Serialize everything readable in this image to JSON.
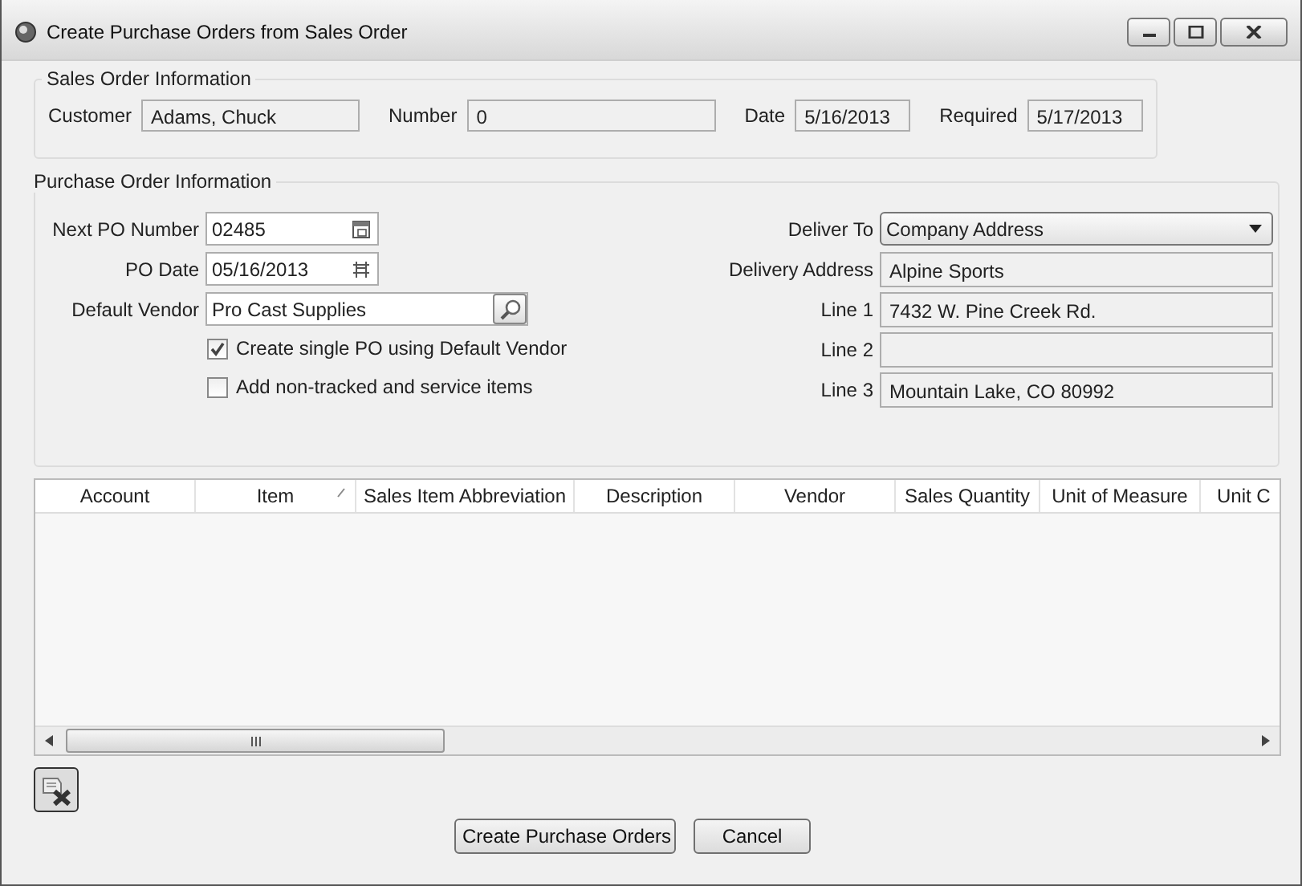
{
  "window": {
    "title": "Create Purchase Orders from Sales Order"
  },
  "sales_order": {
    "title": "Sales Order Information",
    "fields": [
      {
        "label": "Customer",
        "value": "Adams, Chuck"
      },
      {
        "label": "Number",
        "value": "0"
      },
      {
        "label": "Date",
        "value": "5/16/2013"
      },
      {
        "label": "Required",
        "value": "5/17/2013"
      }
    ]
  },
  "purchase_order": {
    "title": "Purchase Order Information",
    "left_fields": [
      {
        "kind": "number",
        "label": "Next PO Number",
        "value": "02485"
      },
      {
        "kind": "date",
        "label": "PO Date",
        "value": "05/16/2013"
      },
      {
        "kind": "lookup",
        "label": "Default Vendor",
        "value": "Pro Cast Supplies"
      }
    ],
    "checkboxes": [
      {
        "label": "Create single PO using Default Vendor",
        "checked": true
      },
      {
        "label": "Add non-tracked and service items",
        "checked": false
      }
    ],
    "right_fields": [
      {
        "kind": "dropdown",
        "label": "Deliver To",
        "value": "Company Address"
      },
      {
        "kind": "text",
        "label": "Delivery Address",
        "value": "Alpine Sports"
      },
      {
        "kind": "text",
        "label": "Line 1",
        "value": "7432 W. Pine Creek Rd."
      },
      {
        "kind": "text",
        "label": "Line 2"
      },
      {
        "kind": "text",
        "label": "Line 3",
        "value": "Mountain Lake, CO  80992"
      }
    ]
  },
  "grid": {
    "columns": [
      {
        "label": "Account",
        "sorted": false
      },
      {
        "label": "Item",
        "sorted": true
      },
      {
        "label": "Sales Item Abbreviation",
        "sorted": false
      },
      {
        "label": "Description",
        "sorted": false
      },
      {
        "label": "Vendor",
        "sorted": false
      },
      {
        "label": "Sales Quantity",
        "sorted": false
      },
      {
        "label": "Unit of Measure",
        "sorted": false
      },
      {
        "label": "Unit C",
        "sorted": false
      }
    ]
  },
  "buttons": [
    "Create Purchase Orders",
    "Cancel"
  ]
}
